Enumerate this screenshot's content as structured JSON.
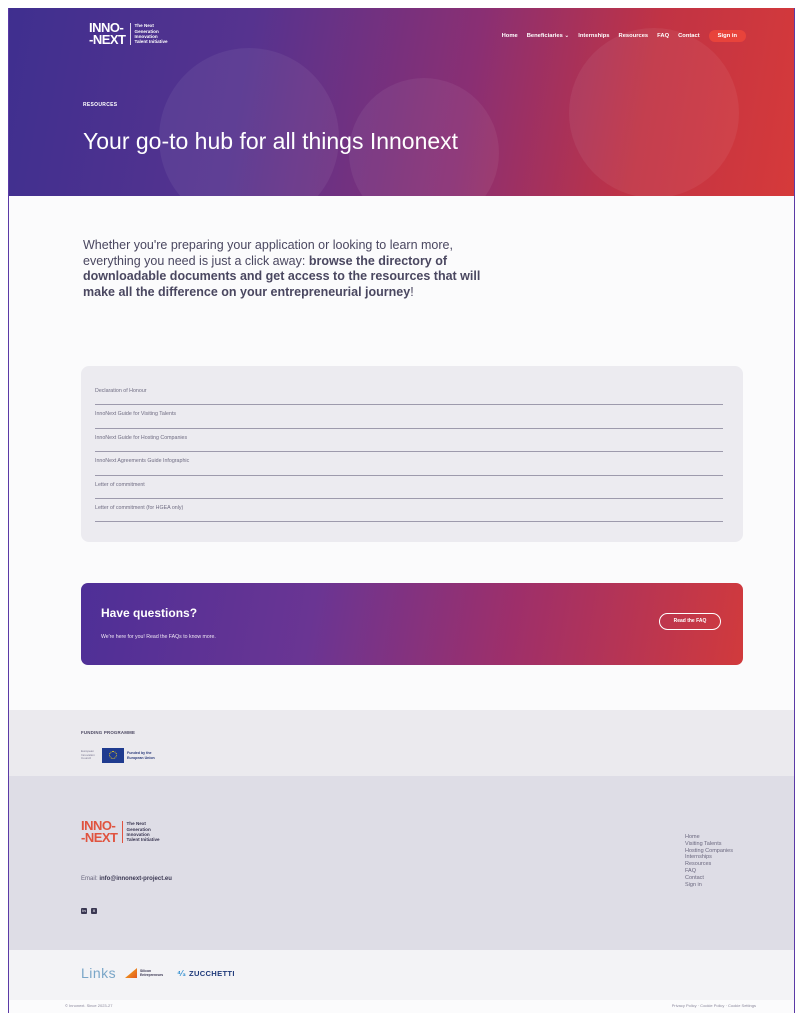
{
  "header": {
    "logo": {
      "mark_line1": "INNO-",
      "mark_line2": "-NEXT",
      "tagline": [
        "The Next",
        "Generation",
        "Innovation",
        "Talent Initiative"
      ]
    },
    "nav": [
      "Home",
      "Beneficiaries ⌄",
      "Internships",
      "Resources",
      "FAQ",
      "Contact"
    ],
    "signin_label": "Sign in"
  },
  "hero": {
    "eyebrow": "RESOURCES",
    "title": "Your go-to hub for all things Innonext"
  },
  "intro": {
    "plain": "Whether you're preparing your application or looking to learn more, everything you need is just a click away: ",
    "bold": "browse the directory of downloadable documents and get access to the resources that will make all the difference on your entrepreneurial journey",
    "end": "!"
  },
  "resources": [
    "Declaration of Honour",
    "InnoNext Guide for Visiting Talents",
    "InnoNext Guide for Hosting Companies",
    "InnoNext Agreements Guide Infographic",
    "Letter of commitment",
    "Letter of commitment (for HGEA only)"
  ],
  "cta": {
    "title": "Have questions?",
    "subtitle": "We're here for you! Read the FAQs to know more.",
    "button_label": "Read the FAQ"
  },
  "funding": {
    "label": "FUNDING PROGRAMME",
    "small_text": [
      "European",
      "Innovation",
      "Council"
    ],
    "eu_text": "Funded by the European Union"
  },
  "footer": {
    "email_label": "Email:",
    "email_value": "info@innonext-project.eu",
    "social": [
      "in",
      "X"
    ],
    "nav": [
      "Home",
      "Visiting Talents",
      "Hosting Companies",
      "Internships",
      "Resources",
      "FAQ",
      "Contact",
      "Sign in"
    ]
  },
  "partners": {
    "links": "Links",
    "sil_text": [
      "Silicon",
      "Entrepreneurs"
    ],
    "zucchetti": "ZUCCHETTI"
  },
  "bottom": {
    "copyright": "© Innonext. Since 2023-27",
    "legal": "Privacy Policy · Cookie Policy · Cookie Settings"
  },
  "colors": {
    "accent_red": "#e8433b",
    "brand_purple": "#4e2f97",
    "hero_gradient_start": "#3f2f8f",
    "hero_gradient_end": "#d63a3a"
  }
}
